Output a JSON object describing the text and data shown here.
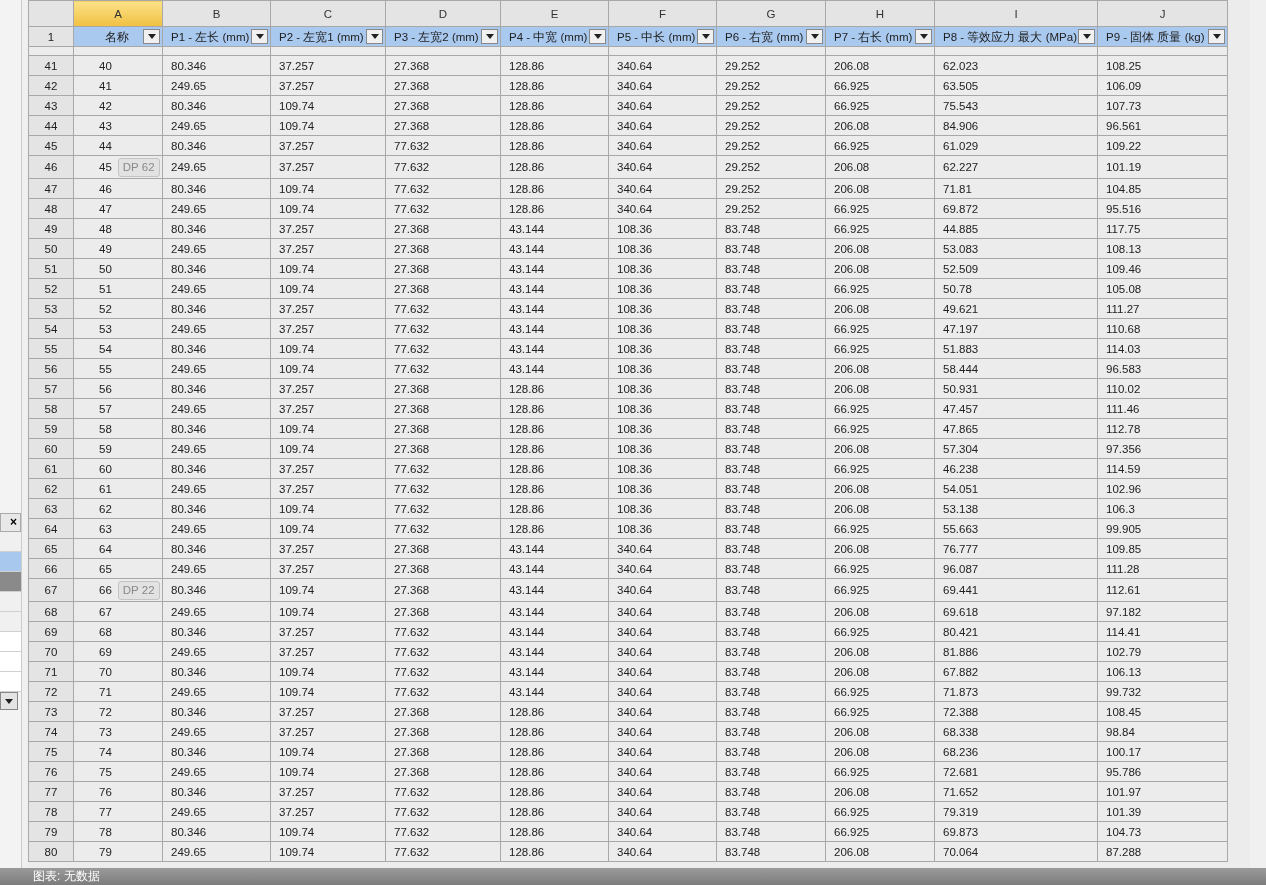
{
  "side_panel": {
    "close": "×",
    "rows": [
      {
        "selected": false,
        "kind": "item"
      },
      {
        "selected": true,
        "kind": "item"
      },
      {
        "selected": false,
        "kind": "group"
      },
      {
        "selected": false,
        "kind": "item"
      },
      {
        "selected": false,
        "kind": "item"
      },
      {
        "selected": false,
        "kind": "field"
      },
      {
        "selected": false,
        "kind": "field"
      },
      {
        "selected": false,
        "kind": "field"
      }
    ]
  },
  "sheet": {
    "column_letters": [
      {
        "label": "A",
        "selected": true
      },
      {
        "label": "B",
        "selected": false
      },
      {
        "label": "C",
        "selected": false
      },
      {
        "label": "D",
        "selected": false
      },
      {
        "label": "E",
        "selected": false
      },
      {
        "label": "F",
        "selected": false
      },
      {
        "label": "G",
        "selected": false
      },
      {
        "label": "H",
        "selected": false
      },
      {
        "label": "I",
        "selected": false
      },
      {
        "label": "J",
        "selected": false
      }
    ],
    "header_row": {
      "number": "1",
      "columns": [
        "名称",
        "P1 - 左长 (mm)",
        "P2 - 左宽1 (mm)",
        "P3 - 左宽2 (mm)",
        "P4 - 中宽 (mm)",
        "P5 - 中长 (mm)",
        "P6 - 右宽 (mm)",
        "P7 - 右长 (mm)",
        "P8 - 等效应力 最大 (MPa)",
        "P9 - 固体 质量 (kg)"
      ]
    },
    "rows": [
      {
        "number": "41",
        "cells": [
          "40",
          "80.346",
          "37.257",
          "27.368",
          "128.86",
          "340.64",
          "29.252",
          "206.08",
          "62.023",
          "108.25"
        ]
      },
      {
        "number": "42",
        "cells": [
          "41",
          "249.65",
          "37.257",
          "27.368",
          "128.86",
          "340.64",
          "29.252",
          "66.925",
          "63.505",
          "106.09"
        ]
      },
      {
        "number": "43",
        "cells": [
          "42",
          "80.346",
          "109.74",
          "27.368",
          "128.86",
          "340.64",
          "29.252",
          "66.925",
          "75.543",
          "107.73"
        ]
      },
      {
        "number": "44",
        "cells": [
          "43",
          "249.65",
          "109.74",
          "27.368",
          "128.86",
          "340.64",
          "29.252",
          "206.08",
          "84.906",
          "96.561"
        ]
      },
      {
        "number": "45",
        "cells": [
          "44",
          "80.346",
          "37.257",
          "77.632",
          "128.86",
          "340.64",
          "29.252",
          "66.925",
          "61.029",
          "109.22"
        ]
      },
      {
        "number": "46",
        "badge": "DP 62",
        "cells": [
          "45",
          "249.65",
          "37.257",
          "77.632",
          "128.86",
          "340.64",
          "29.252",
          "206.08",
          "62.227",
          "101.19"
        ]
      },
      {
        "number": "47",
        "cells": [
          "46",
          "80.346",
          "109.74",
          "77.632",
          "128.86",
          "340.64",
          "29.252",
          "206.08",
          "71.81",
          "104.85"
        ]
      },
      {
        "number": "48",
        "cells": [
          "47",
          "249.65",
          "109.74",
          "77.632",
          "128.86",
          "340.64",
          "29.252",
          "66.925",
          "69.872",
          "95.516"
        ]
      },
      {
        "number": "49",
        "cells": [
          "48",
          "80.346",
          "37.257",
          "27.368",
          "43.144",
          "108.36",
          "83.748",
          "66.925",
          "44.885",
          "117.75"
        ]
      },
      {
        "number": "50",
        "cells": [
          "49",
          "249.65",
          "37.257",
          "27.368",
          "43.144",
          "108.36",
          "83.748",
          "206.08",
          "53.083",
          "108.13"
        ]
      },
      {
        "number": "51",
        "cells": [
          "50",
          "80.346",
          "109.74",
          "27.368",
          "43.144",
          "108.36",
          "83.748",
          "206.08",
          "52.509",
          "109.46"
        ]
      },
      {
        "number": "52",
        "cells": [
          "51",
          "249.65",
          "109.74",
          "27.368",
          "43.144",
          "108.36",
          "83.748",
          "66.925",
          "50.78",
          "105.08"
        ]
      },
      {
        "number": "53",
        "cells": [
          "52",
          "80.346",
          "37.257",
          "77.632",
          "43.144",
          "108.36",
          "83.748",
          "206.08",
          "49.621",
          "111.27"
        ]
      },
      {
        "number": "54",
        "cells": [
          "53",
          "249.65",
          "37.257",
          "77.632",
          "43.144",
          "108.36",
          "83.748",
          "66.925",
          "47.197",
          "110.68"
        ]
      },
      {
        "number": "55",
        "cells": [
          "54",
          "80.346",
          "109.74",
          "77.632",
          "43.144",
          "108.36",
          "83.748",
          "66.925",
          "51.883",
          "114.03"
        ]
      },
      {
        "number": "56",
        "cells": [
          "55",
          "249.65",
          "109.74",
          "77.632",
          "43.144",
          "108.36",
          "83.748",
          "206.08",
          "58.444",
          "96.583"
        ]
      },
      {
        "number": "57",
        "cells": [
          "56",
          "80.346",
          "37.257",
          "27.368",
          "128.86",
          "108.36",
          "83.748",
          "206.08",
          "50.931",
          "110.02"
        ]
      },
      {
        "number": "58",
        "cells": [
          "57",
          "249.65",
          "37.257",
          "27.368",
          "128.86",
          "108.36",
          "83.748",
          "66.925",
          "47.457",
          "111.46"
        ]
      },
      {
        "number": "59",
        "cells": [
          "58",
          "80.346",
          "109.74",
          "27.368",
          "128.86",
          "108.36",
          "83.748",
          "66.925",
          "47.865",
          "112.78"
        ]
      },
      {
        "number": "60",
        "cells": [
          "59",
          "249.65",
          "109.74",
          "27.368",
          "128.86",
          "108.36",
          "83.748",
          "206.08",
          "57.304",
          "97.356"
        ]
      },
      {
        "number": "61",
        "cells": [
          "60",
          "80.346",
          "37.257",
          "77.632",
          "128.86",
          "108.36",
          "83.748",
          "66.925",
          "46.238",
          "114.59"
        ]
      },
      {
        "number": "62",
        "cells": [
          "61",
          "249.65",
          "37.257",
          "77.632",
          "128.86",
          "108.36",
          "83.748",
          "206.08",
          "54.051",
          "102.96"
        ]
      },
      {
        "number": "63",
        "cells": [
          "62",
          "80.346",
          "109.74",
          "77.632",
          "128.86",
          "108.36",
          "83.748",
          "206.08",
          "53.138",
          "106.3"
        ]
      },
      {
        "number": "64",
        "cells": [
          "63",
          "249.65",
          "109.74",
          "77.632",
          "128.86",
          "108.36",
          "83.748",
          "66.925",
          "55.663",
          "99.905"
        ]
      },
      {
        "number": "65",
        "cells": [
          "64",
          "80.346",
          "37.257",
          "27.368",
          "43.144",
          "340.64",
          "83.748",
          "206.08",
          "76.777",
          "109.85"
        ]
      },
      {
        "number": "66",
        "cells": [
          "65",
          "249.65",
          "37.257",
          "27.368",
          "43.144",
          "340.64",
          "83.748",
          "66.925",
          "96.087",
          "111.28"
        ]
      },
      {
        "number": "67",
        "badge": "DP 22",
        "cells": [
          "66",
          "80.346",
          "109.74",
          "27.368",
          "43.144",
          "340.64",
          "83.748",
          "66.925",
          "69.441",
          "112.61"
        ]
      },
      {
        "number": "68",
        "cells": [
          "67",
          "249.65",
          "109.74",
          "27.368",
          "43.144",
          "340.64",
          "83.748",
          "206.08",
          "69.618",
          "97.182"
        ]
      },
      {
        "number": "69",
        "cells": [
          "68",
          "80.346",
          "37.257",
          "77.632",
          "43.144",
          "340.64",
          "83.748",
          "66.925",
          "80.421",
          "114.41"
        ]
      },
      {
        "number": "70",
        "cells": [
          "69",
          "249.65",
          "37.257",
          "77.632",
          "43.144",
          "340.64",
          "83.748",
          "206.08",
          "81.886",
          "102.79"
        ]
      },
      {
        "number": "71",
        "cells": [
          "70",
          "80.346",
          "109.74",
          "77.632",
          "43.144",
          "340.64",
          "83.748",
          "206.08",
          "67.882",
          "106.13"
        ]
      },
      {
        "number": "72",
        "cells": [
          "71",
          "249.65",
          "109.74",
          "77.632",
          "43.144",
          "340.64",
          "83.748",
          "66.925",
          "71.873",
          "99.732"
        ]
      },
      {
        "number": "73",
        "cells": [
          "72",
          "80.346",
          "37.257",
          "27.368",
          "128.86",
          "340.64",
          "83.748",
          "66.925",
          "72.388",
          "108.45"
        ]
      },
      {
        "number": "74",
        "cells": [
          "73",
          "249.65",
          "37.257",
          "27.368",
          "128.86",
          "340.64",
          "83.748",
          "206.08",
          "68.338",
          "98.84"
        ]
      },
      {
        "number": "75",
        "cells": [
          "74",
          "80.346",
          "109.74",
          "27.368",
          "128.86",
          "340.64",
          "83.748",
          "206.08",
          "68.236",
          "100.17"
        ]
      },
      {
        "number": "76",
        "cells": [
          "75",
          "249.65",
          "109.74",
          "27.368",
          "128.86",
          "340.64",
          "83.748",
          "66.925",
          "72.681",
          "95.786"
        ]
      },
      {
        "number": "77",
        "cells": [
          "76",
          "80.346",
          "37.257",
          "77.632",
          "128.86",
          "340.64",
          "83.748",
          "206.08",
          "71.652",
          "101.97"
        ]
      },
      {
        "number": "78",
        "cells": [
          "77",
          "249.65",
          "37.257",
          "77.632",
          "128.86",
          "340.64",
          "83.748",
          "66.925",
          "79.319",
          "101.39"
        ]
      },
      {
        "number": "79",
        "cells": [
          "78",
          "80.346",
          "109.74",
          "77.632",
          "128.86",
          "340.64",
          "83.748",
          "66.925",
          "69.873",
          "104.73"
        ]
      },
      {
        "number": "80",
        "cells": [
          "79",
          "249.65",
          "109.74",
          "77.632",
          "128.86",
          "340.64",
          "83.748",
          "206.08",
          "70.064",
          "87.288"
        ]
      }
    ]
  },
  "status_bar": {
    "text": "图表: 无数据"
  }
}
